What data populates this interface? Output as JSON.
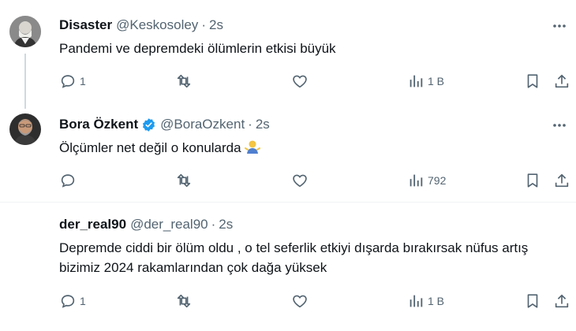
{
  "tweets": [
    {
      "name": "Disaster",
      "handle": "@Keskosoley",
      "dot": "·",
      "time": "2s",
      "text": "Pandemi ve depremdeki ölümlerin etkisi büyük",
      "reply_count": "1",
      "retweet_count": "",
      "like_count": "",
      "views": "1 B",
      "verified": false
    },
    {
      "name": "Bora Özkent",
      "handle": "@BoraOzkent",
      "dot": "·",
      "time": "2s",
      "text": "Ölçümler net değil o konularda",
      "reply_count": "",
      "retweet_count": "",
      "like_count": "",
      "views": "792",
      "verified": true,
      "emoji_icon": "man-shrugging-emoji"
    },
    {
      "name": "der_real90",
      "handle": "@der_real90",
      "dot": "·",
      "time": "2s",
      "text": "Depremde ciddi bir ölüm oldu , o tel seferlik etkiyi dışarda bırakırsak nüfus artış bizimiz 2024 rakamlarından çok dağa yüksek",
      "reply_count": "1",
      "retweet_count": "",
      "like_count": "",
      "views": "1 B",
      "verified": false
    }
  ],
  "colors": {
    "text": "#0f1419",
    "secondary": "#536471",
    "verified": "#1d9bf0",
    "divider": "#eff3f4",
    "thread_line": "#cfd9de"
  }
}
